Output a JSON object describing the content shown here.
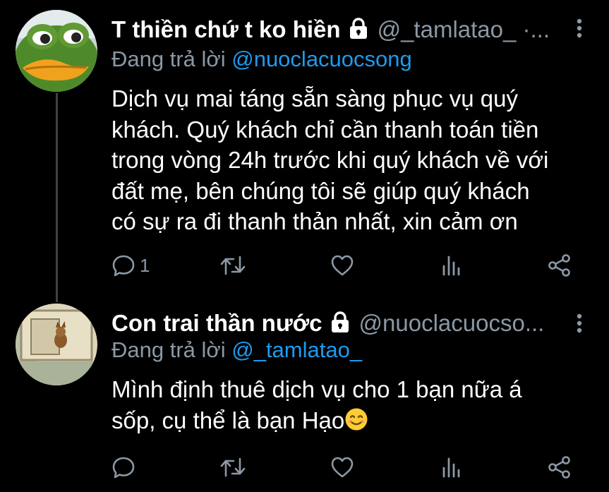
{
  "tweets": [
    {
      "display_name": "T thiền chứ t ko hiền",
      "handle": "@_tamlatao_ ·...",
      "reply_prefix": "Đang trả lời ",
      "reply_mention": "@nuoclacuocsong",
      "text": "Dịch vụ mai táng sẵn sàng phục vụ quý\nkhách. Quý khách chỉ cần thanh toán tiền\ntrong vòng 24h trước khi quý khách về với\nđất mẹ, bên chúng tôi sẽ giúp quý khách\ncó sự ra đi thanh thản nhất, xin cảm ơn",
      "reply_count": "1",
      "avatar_icon": "frog-avatar",
      "locked": true
    },
    {
      "display_name": "Con trai thần nước",
      "handle": "@nuoclacuocso...",
      "reply_prefix": "Đang trả lời ",
      "reply_mention": "@_tamlatao_",
      "text": "Mình định thuê dịch vụ cho 1 bạn nữa á\nsốp, cụ thể là bạn Hạo",
      "emoji": "smiling-face-emoji",
      "reply_count": "",
      "avatar_icon": "cartoon-cat-avatar",
      "locked": true
    }
  ],
  "icons": {
    "reply": "reply-icon",
    "retweet": "retweet-icon",
    "like": "heart-icon",
    "stats": "analytics-icon",
    "share": "share-icon",
    "more": "more-options-icon",
    "lock": "lock-icon"
  },
  "colors": {
    "background": "#000000",
    "text_primary": "#ffffff",
    "text_secondary": "#8b98a5",
    "mention": "#1d9bf0",
    "thread_line": "#3d4248"
  }
}
